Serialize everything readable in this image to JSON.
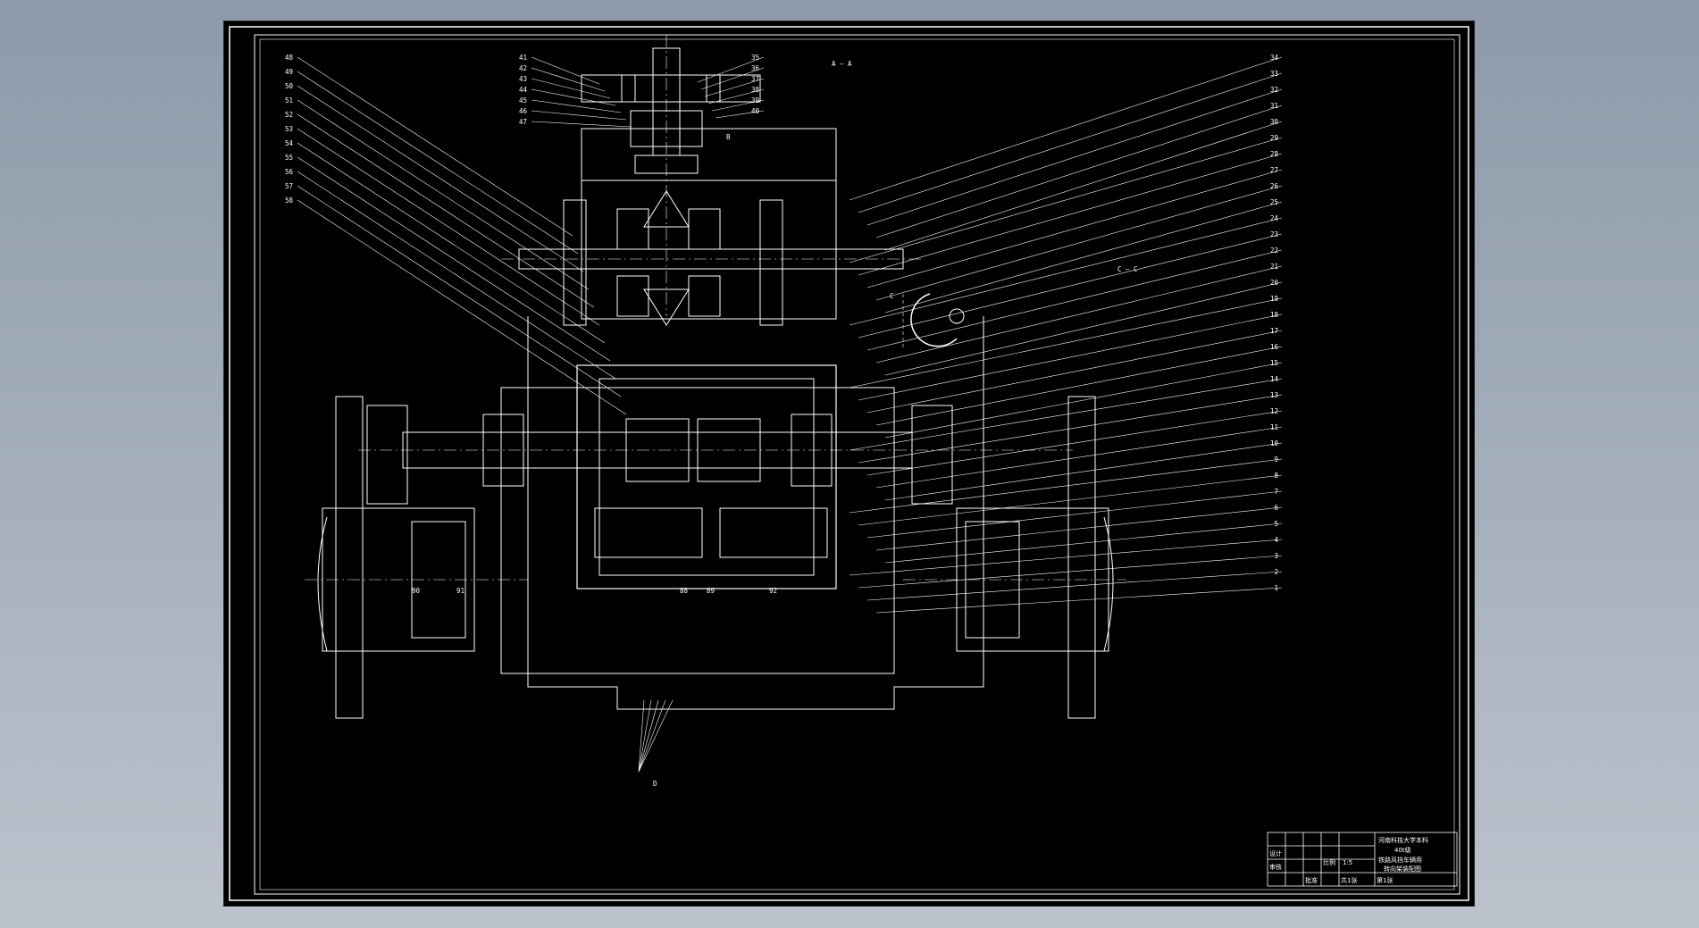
{
  "viewport": {
    "background_color": "#9aa5b3"
  },
  "drawing": {
    "background_color": "#000000",
    "line_color": "#ffffff",
    "section_view_aa": "A — A",
    "section_view_cc": "C — C",
    "section_marker_b": "B",
    "section_marker_d": "D",
    "section_marker_c": "C",
    "left_callouts": [
      "48",
      "49",
      "50",
      "51",
      "52",
      "53",
      "54",
      "55",
      "56",
      "57",
      "58"
    ],
    "top_left_callouts": [
      "41",
      "42",
      "43",
      "44",
      "45",
      "46",
      "47"
    ],
    "top_center_callouts": [
      "35",
      "36",
      "37",
      "38",
      "39",
      "40"
    ],
    "right_callouts": [
      "34",
      "33",
      "32",
      "31",
      "30",
      "29",
      "28",
      "27",
      "26",
      "25",
      "24",
      "23",
      "22",
      "21",
      "20",
      "19",
      "18",
      "17",
      "16",
      "15",
      "14",
      "13",
      "12",
      "11",
      "10",
      "9",
      "8",
      "7",
      "6",
      "5",
      "4",
      "3",
      "2",
      "1"
    ],
    "bottom_callouts": [
      "90",
      "91",
      "88",
      "89",
      "92"
    ]
  },
  "title_block": {
    "university": "河南科技大学本科",
    "project_line1": "40t级",
    "project_line2": "铁路风挡车辆用",
    "project_line3": "转向架装配图",
    "scale_label": "比例",
    "scale_value": "1:5",
    "sheet_total": "共1张",
    "sheet_no": "第1张",
    "drawn_by": "设计",
    "checked_by": "审核",
    "approved_by": "批准"
  }
}
